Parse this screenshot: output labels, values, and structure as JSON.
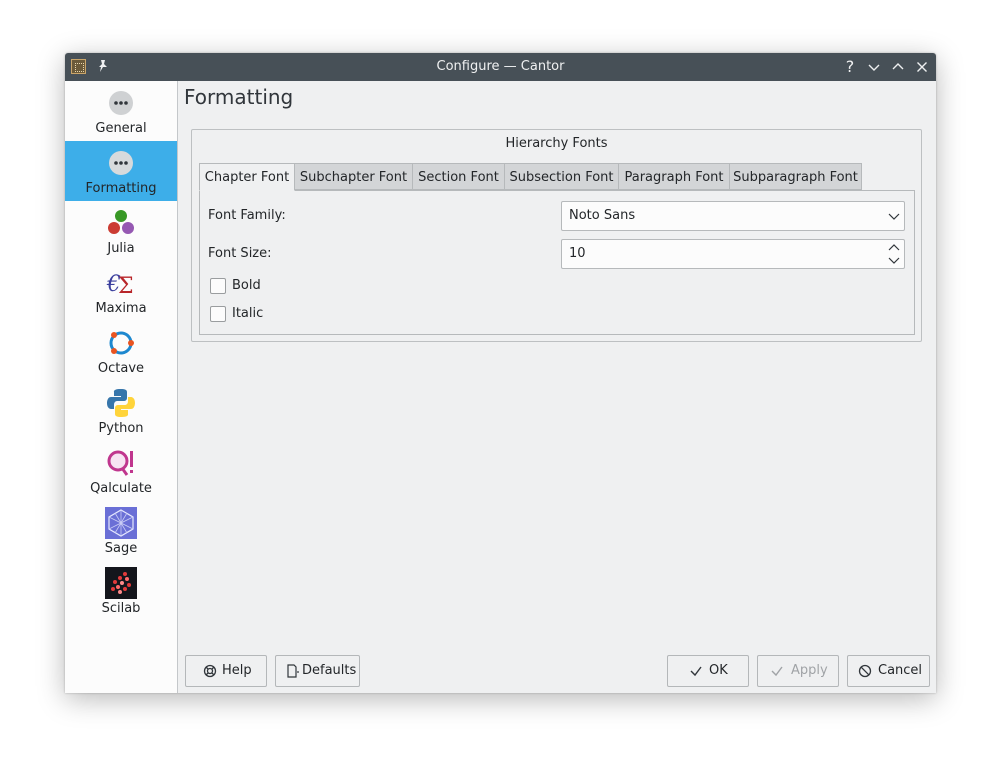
{
  "window": {
    "title": "Configure — Cantor"
  },
  "titlebar": {
    "help_glyph": "?"
  },
  "sidebar": {
    "items": [
      {
        "label": "General",
        "icon": "more-dots-icon"
      },
      {
        "label": "Formatting",
        "icon": "more-dots-icon",
        "selected": true
      },
      {
        "label": "Julia",
        "icon": "julia-logo-icon"
      },
      {
        "label": "Maxima",
        "icon": "maxima-logo-icon"
      },
      {
        "label": "Octave",
        "icon": "octave-logo-icon"
      },
      {
        "label": "Python",
        "icon": "python-logo-icon"
      },
      {
        "label": "Qalculate",
        "icon": "qalculate-logo-icon"
      },
      {
        "label": "Sage",
        "icon": "sage-logo-icon"
      },
      {
        "label": "Scilab",
        "icon": "scilab-logo-icon"
      }
    ]
  },
  "page": {
    "title": "Formatting",
    "group_title": "Hierarchy Fonts",
    "tabs": [
      {
        "label": "Chapter Font",
        "active": true
      },
      {
        "label": "Subchapter Font"
      },
      {
        "label": "Section Font"
      },
      {
        "label": "Subsection Font"
      },
      {
        "label": "Paragraph Font"
      },
      {
        "label": "Subparagraph Font"
      }
    ],
    "font_family_label": "Font Family:",
    "font_family_value": "Noto Sans",
    "font_size_label": "Font Size:",
    "font_size_value": "10",
    "bold_label": "Bold",
    "bold_checked": false,
    "italic_label": "Italic",
    "italic_checked": false
  },
  "buttons": {
    "help": "Help",
    "defaults": "Defaults",
    "ok": "OK",
    "apply": "Apply",
    "cancel": "Cancel"
  },
  "colors": {
    "titlebar": "#475057",
    "selection": "#3daee9",
    "window_bg": "#eff0f1"
  }
}
